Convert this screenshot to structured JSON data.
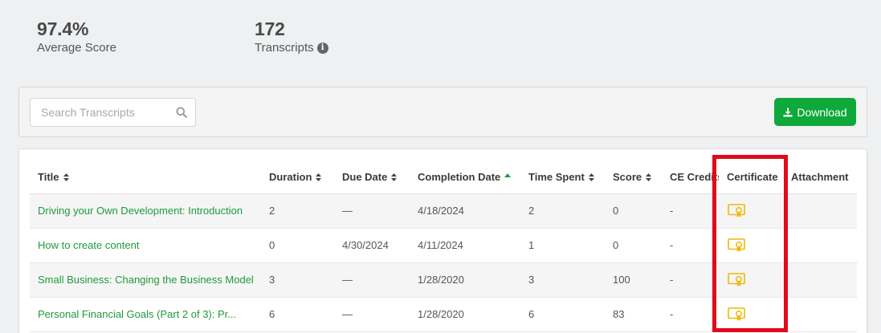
{
  "stats": [
    {
      "value": "97.4%",
      "label": "Average Score"
    },
    {
      "value": "172",
      "label": "Transcripts",
      "info_icon": "info-circle-icon"
    }
  ],
  "toolbar": {
    "search_placeholder": "Search Transcripts",
    "search_icon": "search-icon",
    "download_label": "Download",
    "download_icon": "download-icon",
    "accent_color": "#0fa83b"
  },
  "table": {
    "columns": [
      {
        "label": "Title",
        "sort": "both"
      },
      {
        "label": "Duration",
        "sort": "both"
      },
      {
        "label": "Due Date",
        "sort": "both"
      },
      {
        "label": "Completion Date",
        "sort": "asc"
      },
      {
        "label": "Time Spent",
        "sort": "both"
      },
      {
        "label": "Score",
        "sort": "both"
      },
      {
        "label": "CE Credits",
        "sort": "none"
      },
      {
        "label": "Certificate",
        "sort": "none"
      },
      {
        "label": "Attachment",
        "sort": "none"
      }
    ],
    "rows": [
      {
        "title": "Driving your Own Development: Introduction",
        "duration": "2",
        "due_date": "—",
        "completion_date": "4/18/2024",
        "time_spent": "2",
        "score": "0",
        "ce_credits": "-",
        "certificate": "certificate-icon",
        "attachment": ""
      },
      {
        "title": "How to create content",
        "duration": "0",
        "due_date": "4/30/2024",
        "completion_date": "4/11/2024",
        "time_spent": "1",
        "score": "0",
        "ce_credits": "-",
        "certificate": "certificate-icon",
        "attachment": ""
      },
      {
        "title": "Small Business: Changing the Business Model",
        "duration": "3",
        "due_date": "—",
        "completion_date": "1/28/2020",
        "time_spent": "3",
        "score": "100",
        "ce_credits": "-",
        "certificate": "certificate-icon",
        "attachment": ""
      },
      {
        "title": "Personal Financial Goals (Part 2 of 3): Pr...",
        "duration": "6",
        "due_date": "—",
        "completion_date": "1/28/2020",
        "time_spent": "6",
        "score": "83",
        "ce_credits": "-",
        "certificate": "certificate-icon",
        "attachment": ""
      }
    ]
  },
  "highlight_color": "#e00b1a",
  "certificate_color": "#f2b705"
}
